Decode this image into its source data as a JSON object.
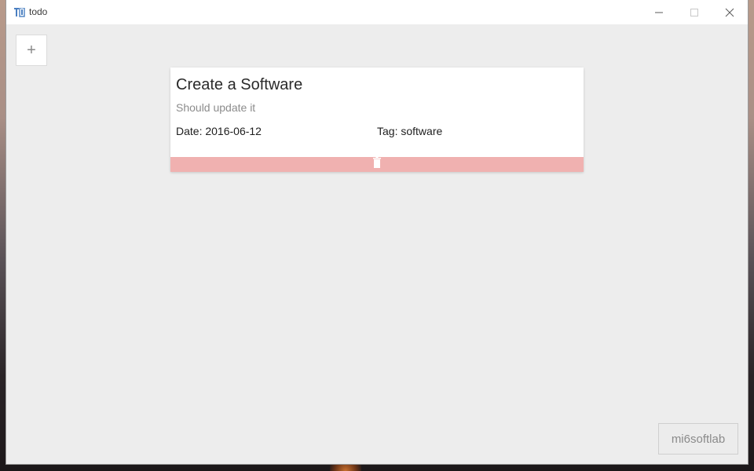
{
  "window": {
    "title": "todo",
    "app_icon": "todo-app-icon",
    "controls": {
      "minimize": "minimize-icon",
      "maximize": "maximize-icon",
      "close": "close-icon"
    }
  },
  "toolbar": {
    "add_label": "+"
  },
  "todos": [
    {
      "title": "Create a Software",
      "description": "Should update it",
      "date": "Date: 2016-06-12",
      "tag": "Tag: software",
      "delete_icon": "trash-icon"
    }
  ],
  "footer": {
    "brand_label": "mi6softlab"
  },
  "colors": {
    "window_bg": "#ededed",
    "card_bg": "#ffffff",
    "delete_bar": "#f0b1b0",
    "app_icon_blue": "#4a7fc1"
  }
}
